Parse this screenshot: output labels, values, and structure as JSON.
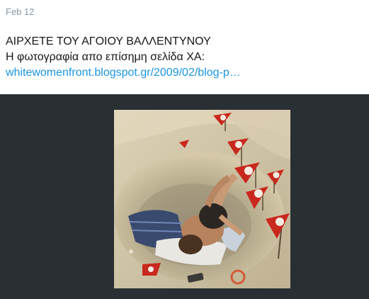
{
  "tweet": {
    "date": "Feb 12",
    "text_line1": "ΑΙΡΧΕΤΕ ΤΟΥ ΑΓΟΙΟΥ ΒΑΛΛΕΝΤΥΝΟΥ",
    "text_line2": "Η φωτογραφία απο επίσημη σελίδα ΧΑ:",
    "link": "whitewomenfront.blogspot.gr/2009/02/blog-p…"
  },
  "media": {
    "background_color": "#292f33",
    "sand_color": "#cdbf9f",
    "flag_color": "#c8281e"
  }
}
